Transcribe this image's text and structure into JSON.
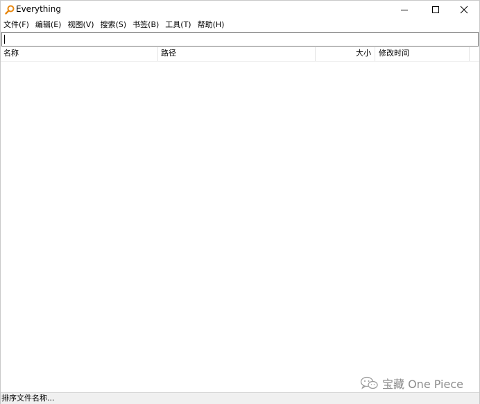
{
  "window": {
    "title": "Everything",
    "icon": "magnifier-key-icon",
    "accent_color": "#e8870e"
  },
  "menu": {
    "items": [
      {
        "label": "文件(F)"
      },
      {
        "label": "编辑(E)"
      },
      {
        "label": "视图(V)"
      },
      {
        "label": "搜索(S)"
      },
      {
        "label": "书签(B)"
      },
      {
        "label": "工具(T)"
      },
      {
        "label": "帮助(H)"
      }
    ]
  },
  "search": {
    "value": ""
  },
  "columns": {
    "name": "名称",
    "path": "路径",
    "size": "大小",
    "modified": "修改时间"
  },
  "status": {
    "text": "排序文件名称..."
  },
  "watermark": {
    "text": "宝藏 One Piece",
    "icon": "wechat-icon"
  }
}
